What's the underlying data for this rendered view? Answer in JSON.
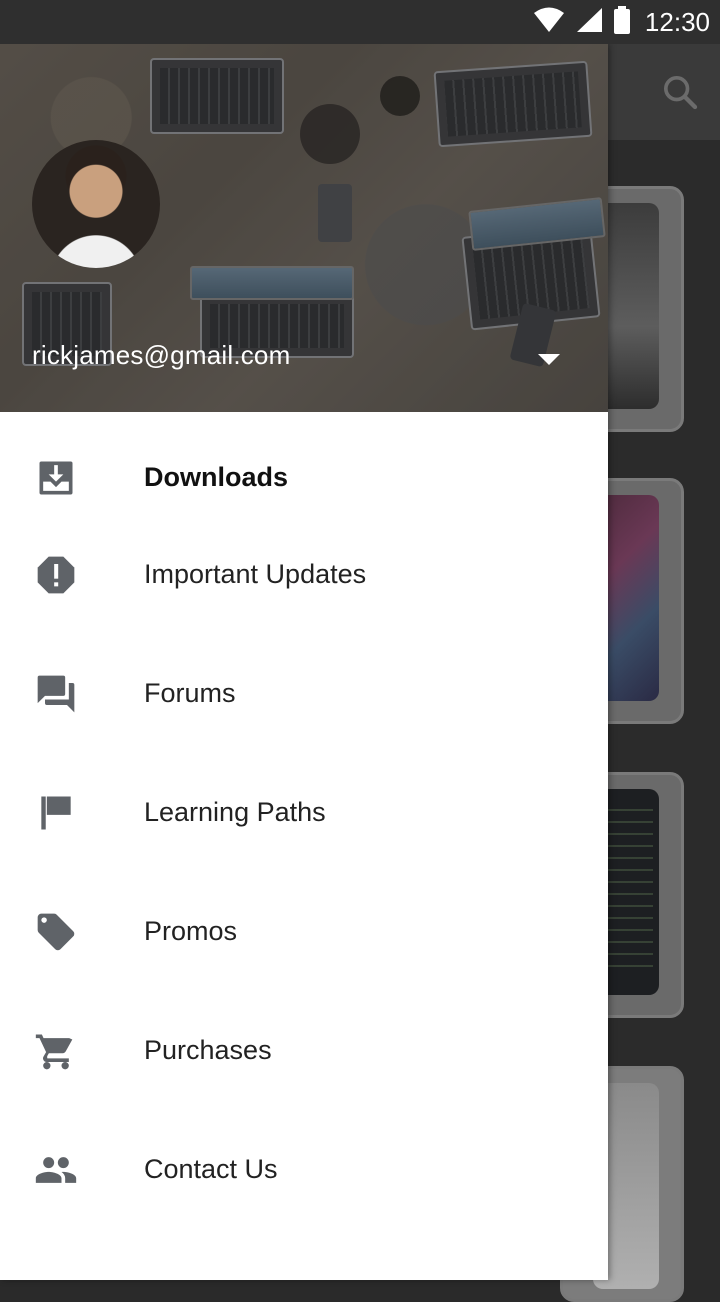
{
  "status_bar": {
    "time": "12:30"
  },
  "account": {
    "email": "rickjames@gmail.com"
  },
  "menu": {
    "items": [
      {
        "label": "Downloads",
        "icon": "download-icon"
      },
      {
        "label": "Important Updates",
        "icon": "alert-icon"
      },
      {
        "label": "Forums",
        "icon": "forum-icon"
      },
      {
        "label": "Learning Paths",
        "icon": "flag-icon"
      },
      {
        "label": "Promos",
        "icon": "tag-icon"
      },
      {
        "label": "Purchases",
        "icon": "cart-icon"
      },
      {
        "label": "Contact Us",
        "icon": "people-icon"
      }
    ]
  },
  "colors": {
    "icon": "#5f6368",
    "text": "#222222",
    "scrim": "#2b2b2b"
  }
}
